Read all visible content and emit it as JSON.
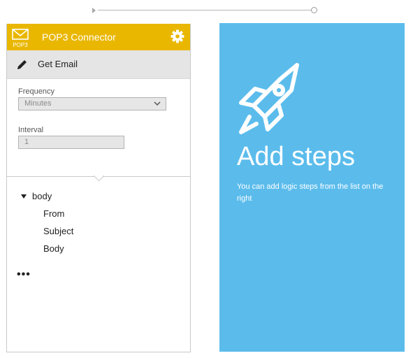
{
  "connector": {
    "title": "POP3 Connector",
    "logo_text": "POP3",
    "action_label": "Get Email"
  },
  "form": {
    "frequency_label": "Frequency",
    "frequency_value": "Minutes",
    "interval_label": "Interval",
    "interval_value": "1"
  },
  "outputs": {
    "parent": "body",
    "children": [
      "From",
      "Subject",
      "Body"
    ],
    "more": "•••"
  },
  "panel": {
    "heading": "Add steps",
    "description": "You can add logic steps from the list on the right"
  },
  "colors": {
    "connector_header": "#e9b700",
    "panel_background": "#5bbcec"
  },
  "icons": [
    "mail-icon",
    "gear-icon",
    "pencil-icon",
    "chevron-down-icon",
    "collapse-triangle-icon",
    "rocket-icon"
  ]
}
